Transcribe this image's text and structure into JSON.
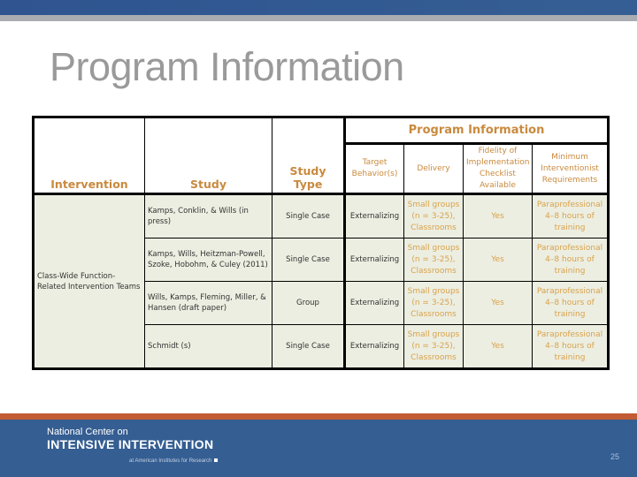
{
  "slide": {
    "title": "Program Information",
    "page_number": "25"
  },
  "table": {
    "group_header": "Program Information",
    "columns": {
      "intervention": "Intervention",
      "study": "Study",
      "study_type": "Study Type",
      "target": "Target Behavior(s)",
      "delivery": "Delivery",
      "fidelity": "Fidelity of Implementation Checklist Available",
      "minimum": "Minimum Interventionist Requirements"
    },
    "intervention_name": "Class-Wide Function-Related Intervention Teams",
    "rows": [
      {
        "study": "Kamps, Conklin, & Wills (in press)",
        "study_type": "Single Case",
        "target": "Externalizing",
        "delivery": "Small groups (n = 3-25), Classrooms",
        "fidelity": "Yes",
        "minimum": "Paraprofessional 4–8 hours of training"
      },
      {
        "study": "Kamps, Wills, Heitzman-Powell, Szoke, Hobohm, & Culey (2011)",
        "study_type": "Single Case",
        "target": "Externalizing",
        "delivery": "Small groups (n = 3-25), Classrooms",
        "fidelity": "Yes",
        "minimum": "Paraprofessional 4–8 hours of training"
      },
      {
        "study": "Wills, Kamps, Fleming, Miller, & Hansen (draft paper)",
        "study_type": "Group",
        "target": "Externalizing",
        "delivery": "Small groups (n = 3-25), Classrooms",
        "fidelity": "Yes",
        "minimum": "Paraprofessional 4–8 hours of training"
      },
      {
        "study": "Schmidt (s)",
        "study_type": "Single Case",
        "target": "Externalizing",
        "delivery": "Small groups (n = 3-25), Classrooms",
        "fidelity": "Yes",
        "minimum": "Paraprofessional 4–8 hours of training"
      }
    ]
  },
  "footer": {
    "line1": "National Center on",
    "line2": "INTENSIVE INTERVENTION",
    "line3": "at American Institutes for Research"
  },
  "colors": {
    "brand_blue": "#355e92",
    "accent_orange": "#c35b33",
    "header_text": "#c98a3e",
    "cell_bg": "#eceee1"
  }
}
